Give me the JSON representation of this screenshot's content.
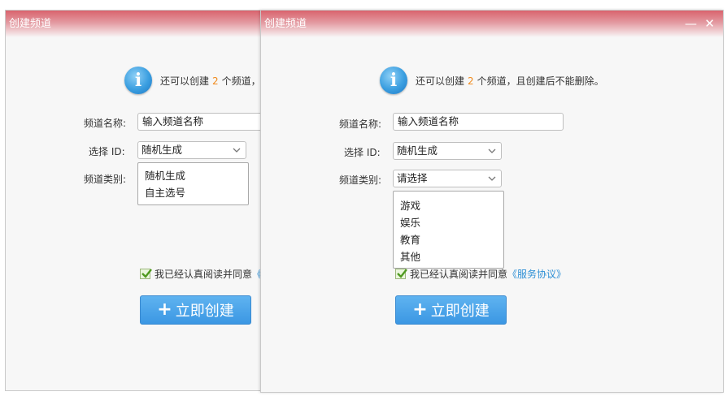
{
  "window_left": {
    "title": "创建频道",
    "info_prefix": "还可以创建",
    "info_count": "2",
    "info_suffix": "个频道，",
    "name_label": "频道名称:",
    "name_value": "输入频道名称",
    "id_label": "选择 ID:",
    "id_value": "随机生成",
    "category_label": "频道类别:",
    "id_options": [
      "随机生成",
      "自主选号"
    ],
    "agree_text": "我已经认真阅读并同意",
    "agree_link": "《",
    "create_label": "立即创建"
  },
  "window_right": {
    "title": "创建频道",
    "minimize": "—",
    "close": "✕",
    "info_prefix": "还可以创建",
    "info_count": "2",
    "info_suffix": "个频道，且创建后不能删除。",
    "name_label": "频道名称:",
    "name_value": "输入频道名称",
    "id_label": "选择 ID:",
    "id_value": "随机生成",
    "category_label": "频道类别:",
    "category_value": "请选择",
    "category_options": [
      "游戏",
      "娱乐",
      "教育",
      "其他"
    ],
    "agree_text": "我已经认真阅读并同意",
    "agree_link": "《服务协议》",
    "create_label": "立即创建"
  },
  "colors": {
    "title_gradient_top": "#d9636d",
    "accent_number": "#f08a1d",
    "link": "#2d8fd5",
    "button": "#3b97e3"
  }
}
